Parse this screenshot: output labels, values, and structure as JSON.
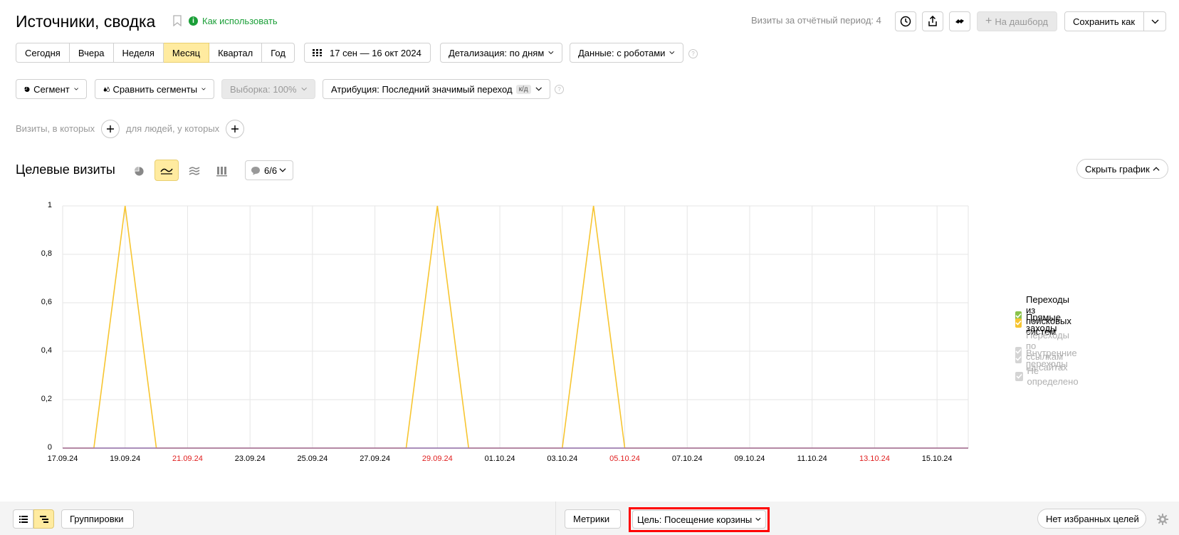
{
  "page": {
    "title": "Источники, сводка",
    "how_to_use": "Как использовать",
    "visits_info": "Визиты за отчётный период: 4"
  },
  "toolbar": {
    "to_dashboard": "На дашборд",
    "save_as": "Сохранить как"
  },
  "periods": [
    "Сегодня",
    "Вчера",
    "Неделя",
    "Месяц",
    "Квартал",
    "Год"
  ],
  "period_active_index": 3,
  "filters": {
    "date_range": "17 сен — 16 окт 2024",
    "detail": "Детализация: по дням",
    "data": "Данные: с роботами",
    "segment": "Сегмент",
    "compare": "Сравнить сегменты",
    "sample": "Выборка: 100%",
    "attribution": "Атрибуция: Последний значимый переход",
    "attribution_badge": "к/д",
    "help": "?"
  },
  "conditions": {
    "visits_where": "Визиты, в которых",
    "people_where": "для людей, у которых"
  },
  "chart_header": {
    "title": "Целевые визиты",
    "annotations": "6/6",
    "hide_chart": "Скрыть график"
  },
  "chart_data": {
    "type": "line",
    "x": [
      "17.09.24",
      "18.09.24",
      "19.09.24",
      "20.09.24",
      "21.09.24",
      "22.09.24",
      "23.09.24",
      "24.09.24",
      "25.09.24",
      "26.09.24",
      "27.09.24",
      "28.09.24",
      "29.09.24",
      "30.09.24",
      "01.10.24",
      "02.10.24",
      "03.10.24",
      "04.10.24",
      "05.10.24",
      "06.10.24",
      "07.10.24",
      "08.10.24",
      "09.10.24",
      "10.10.24",
      "11.10.24",
      "12.10.24",
      "13.10.24",
      "14.10.24",
      "15.10.24",
      "16.10.24"
    ],
    "x_tick_labels": [
      "17.09.24",
      "19.09.24",
      "21.09.24",
      "23.09.24",
      "25.09.24",
      "27.09.24",
      "29.09.24",
      "01.10.24",
      "03.10.24",
      "05.10.24",
      "07.10.24",
      "09.10.24",
      "11.10.24",
      "13.10.24",
      "15.10.24"
    ],
    "weekend_tick_labels": [
      "21.09.24",
      "29.09.24",
      "05.10.24",
      "13.10.24"
    ],
    "y_ticks": [
      "0",
      "0,2",
      "0,4",
      "0,6",
      "0,8",
      "1"
    ],
    "ylim": [
      0,
      1
    ],
    "grid": true,
    "legend_position": "right",
    "series": [
      {
        "name": "Переходы из поисковых систем",
        "color": "#8ac24a",
        "enabled": true,
        "values": [
          0,
          0,
          0,
          0,
          0,
          0,
          0,
          0,
          0,
          0,
          0,
          0,
          0,
          0,
          0,
          0,
          0,
          0,
          0,
          0,
          0,
          0,
          0,
          0,
          0,
          0,
          0,
          0,
          0,
          0
        ]
      },
      {
        "name": "Прямые заходы",
        "color": "#f7c531",
        "enabled": true,
        "values": [
          0,
          0,
          1,
          0,
          0,
          0,
          0,
          0,
          0,
          0,
          0,
          0,
          1,
          0,
          0,
          0,
          0,
          1,
          0,
          0,
          0,
          0,
          0,
          0,
          0,
          0,
          0,
          0,
          0,
          0
        ]
      },
      {
        "name": "Переходы по ссылкам на сайтах",
        "color": "#b7b7b7",
        "enabled": false
      },
      {
        "name": "Внутренние переходы",
        "color": "#b7b7b7",
        "enabled": false
      },
      {
        "name": "Не определено",
        "color": "#b7b7b7",
        "enabled": false
      }
    ],
    "baseline_color": "#9a5cc6"
  },
  "footer": {
    "groupings": "Группировки",
    "metrics": "Метрики",
    "goal": "Цель: Посещение корзины",
    "no_fav_goals": "Нет избранных целей"
  },
  "colors": {
    "accent_active": "#ffeba0",
    "how_to_use_green": "#1b9f38",
    "weekend_red": "#e02020",
    "highlight_border": "#ff0000"
  }
}
